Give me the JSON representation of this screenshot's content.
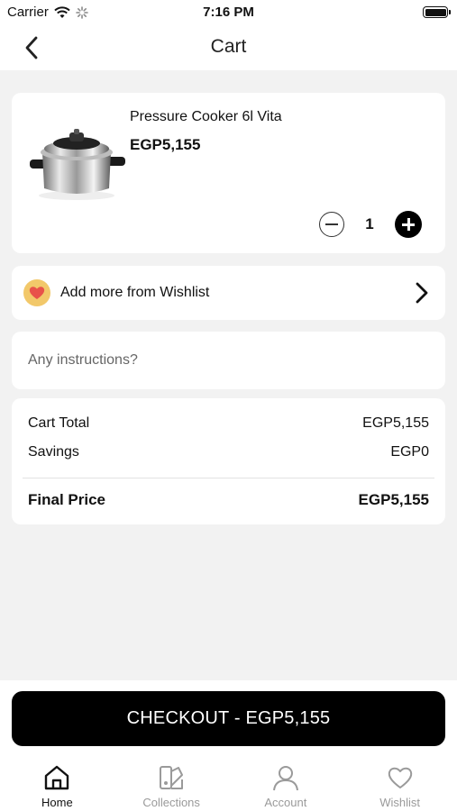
{
  "status_bar": {
    "carrier": "Carrier",
    "time": "7:16 PM"
  },
  "nav": {
    "title": "Cart",
    "back_icon": "chevron-left-icon"
  },
  "cart_item": {
    "name": "Pressure Cooker 6l Vita",
    "price": "EGP5,155",
    "quantity": "1",
    "image_icon": "pressure-cooker-image"
  },
  "wishlist_row": {
    "label": "Add more from Wishlist",
    "icon": "heart-icon",
    "chevron_icon": "chevron-right-icon"
  },
  "instructions": {
    "placeholder": "Any instructions?",
    "value": ""
  },
  "totals": {
    "cart_total_label": "Cart Total",
    "cart_total_value": "EGP5,155",
    "savings_label": "Savings",
    "savings_value": "EGP0",
    "final_label": "Final Price",
    "final_value": "EGP5,155"
  },
  "checkout": {
    "label": "CHECKOUT - EGP5,155"
  },
  "tabbar": {
    "items": [
      {
        "label": "Home",
        "icon": "home-icon",
        "active": true
      },
      {
        "label": "Collections",
        "icon": "collections-icon",
        "active": false
      },
      {
        "label": "Account",
        "icon": "account-icon",
        "active": false
      },
      {
        "label": "Wishlist",
        "icon": "heart-outline-icon",
        "active": false
      }
    ]
  },
  "colors": {
    "accent": "#000000",
    "background": "#f2f2f2",
    "heart": "#e8524a",
    "heart_badge": "#f2c86a",
    "inactive_tab": "#9a9a9a"
  }
}
